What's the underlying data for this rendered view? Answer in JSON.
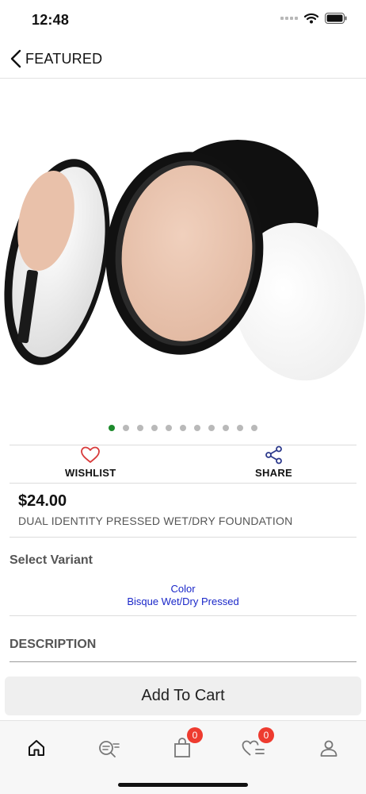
{
  "status_bar": {
    "time": "12:48"
  },
  "nav": {
    "title": "FEATURED"
  },
  "carousel": {
    "total": 11,
    "active_index": 0,
    "active_color": "#1d8a2c"
  },
  "actions": {
    "wishlist_label": "WISHLIST",
    "share_label": "SHARE",
    "wishlist_icon": "heart-outline-icon",
    "share_icon": "share-icon"
  },
  "product": {
    "price": "$24.00",
    "name": "DUAL IDENTITY PRESSED WET/DRY FOUNDATION"
  },
  "variant": {
    "section_title": "Select Variant",
    "option_name": "Color",
    "option_value": "Bisque Wet/Dry Pressed",
    "link_color": "#1a27c9"
  },
  "description": {
    "section_title": "DESCRIPTION"
  },
  "cart_button": {
    "label": "Add To Cart"
  },
  "tab_bar": {
    "tabs": [
      {
        "name": "home",
        "icon": "home-icon"
      },
      {
        "name": "search",
        "icon": "search-list-icon"
      },
      {
        "name": "cart",
        "icon": "shopping-bag-icon",
        "badge": "0"
      },
      {
        "name": "wishlist",
        "icon": "heart-list-icon",
        "badge": "0"
      },
      {
        "name": "account",
        "icon": "user-icon"
      }
    ],
    "badge_color": "#ee3b2f"
  }
}
